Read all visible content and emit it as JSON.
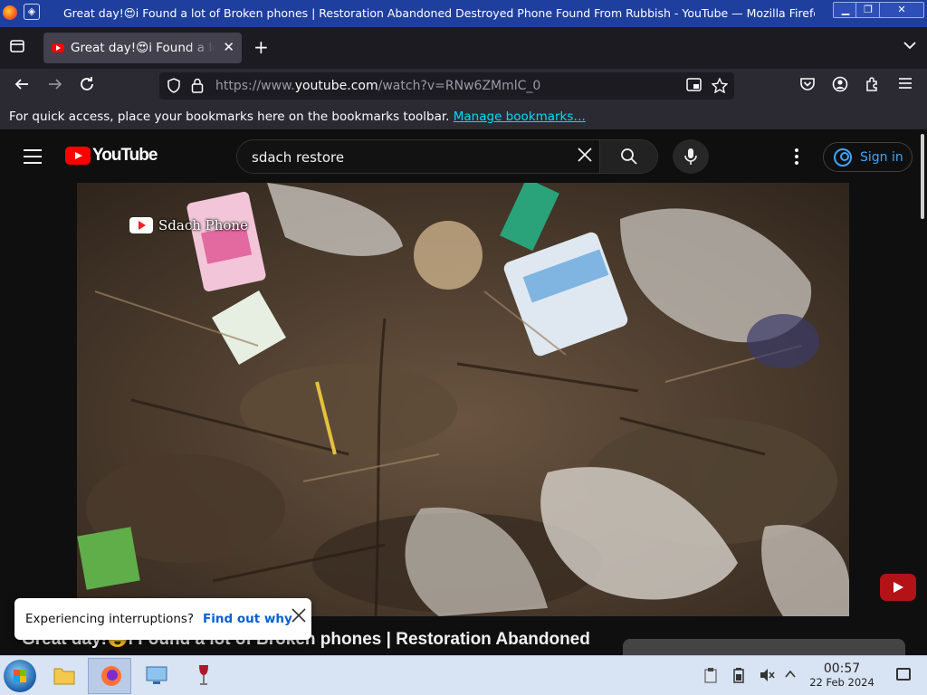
{
  "window": {
    "title": "Great day!😍i Found a lot of Broken phones | Restoration Abandoned Destroyed Phone Found From Rubbish - YouTube — Mozilla Firefox"
  },
  "tabs": [
    {
      "label": "Great day!😍i Found a lot of Broken phones | Restoration Abandoned Destroyed Phone Found From Rubbish"
    }
  ],
  "navbar": {
    "url_prefix": "https://www.",
    "url_host": "youtube.com",
    "url_path": "/watch?v=RNw6ZMmlC_0"
  },
  "bookmarks": {
    "message": "For quick access, place your bookmarks here on the bookmarks toolbar.",
    "link": "Manage bookmarks…"
  },
  "youtube": {
    "logo_text": "YouTube",
    "search_value": "sdach restore",
    "sign_in": "Sign in",
    "watermark": "Sdach Phone",
    "video_title": "Great day!😍i Found a lot of Broken phones | Restoration Abandoned",
    "toast": {
      "message": "Experiencing interruptions?",
      "link": "Find out why"
    }
  },
  "taskbar": {
    "time": "00:57",
    "date": "22 Feb 2024"
  },
  "colors": {
    "titlebar": "#1e3f9e",
    "yt_red": "#ff0000",
    "link_blue": "#3ea6ff",
    "bookmark_link": "#00ddff"
  },
  "icons": [
    "firefox-icon",
    "list-all-tabs-icon",
    "youtube-favicon",
    "close-icon",
    "plus-icon",
    "chevron-down-icon",
    "back-arrow-icon",
    "forward-arrow-icon",
    "reload-icon",
    "shield-icon",
    "lock-icon",
    "picture-in-picture-icon",
    "star-icon",
    "pocket-icon",
    "account-icon",
    "extensions-icon",
    "menu-icon",
    "hamburger-icon",
    "search-icon",
    "mic-icon",
    "kebab-icon",
    "user-icon"
  ]
}
